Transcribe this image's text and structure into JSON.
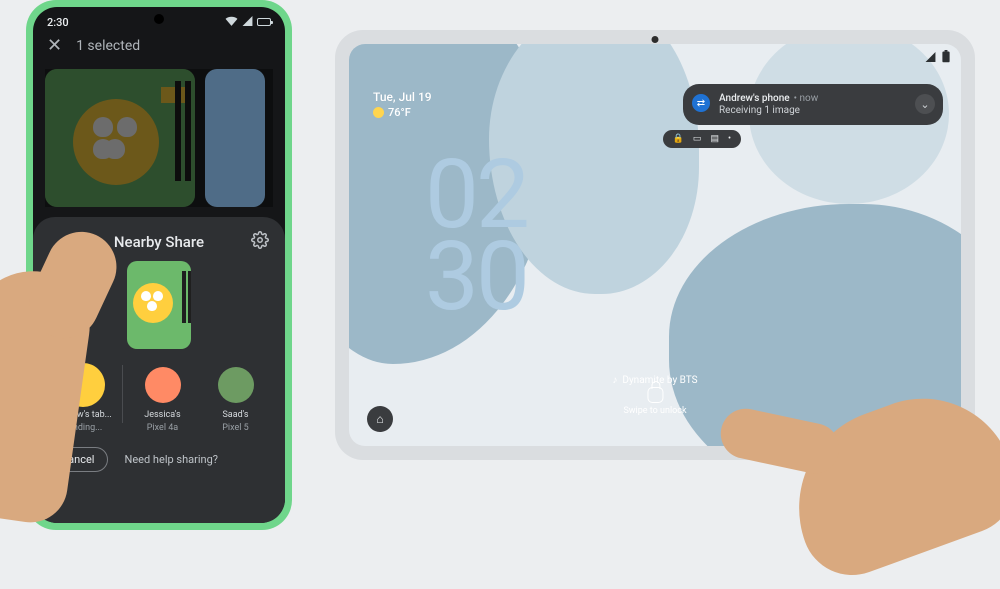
{
  "phone": {
    "status_time": "2:30",
    "topbar": {
      "selected_label": "1 selected"
    },
    "sheet": {
      "title": "Nearby Share",
      "targets": [
        {
          "name": "Andrew's tab...",
          "status": "Sending...",
          "avatar_bg": "#ffcf3e"
        },
        {
          "name": "Jessica's",
          "status": "Pixel 4a",
          "avatar_bg": "#ff8a65"
        },
        {
          "name": "Saad's",
          "status": "Pixel 5",
          "avatar_bg": "#6d9b62"
        }
      ],
      "cancel_label": "Cancel",
      "help_label": "Need help sharing?"
    }
  },
  "tablet": {
    "date": "Tue, Jul 19",
    "temp": "76°F",
    "clock_top": "02",
    "clock_bottom": "30",
    "notification": {
      "title": "Andrew's phone",
      "meta": "now",
      "body": "Receiving 1 image"
    },
    "now_playing": "Dynamite by BTS",
    "unlock_label": "Swipe to unlock"
  }
}
